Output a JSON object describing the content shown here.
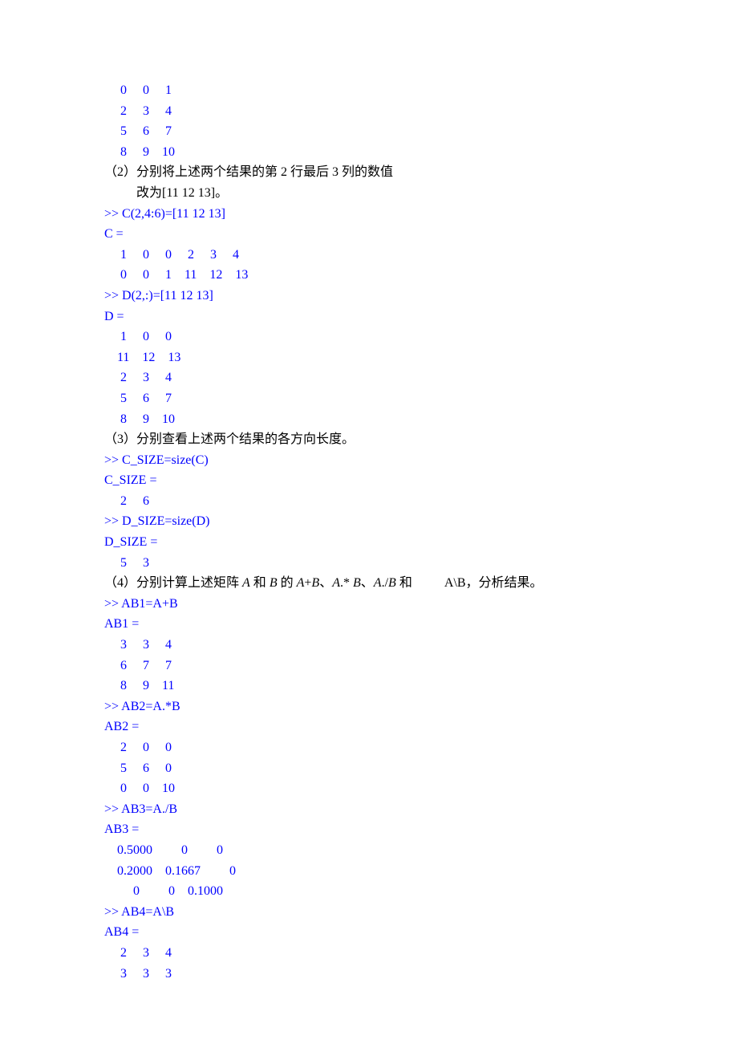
{
  "lines": [
    {
      "cls": "code",
      "text": "     0     0     1"
    },
    {
      "cls": "code",
      "text": "     2     3     4"
    },
    {
      "cls": "code",
      "text": "     5     6     7"
    },
    {
      "cls": "code",
      "text": "     8     9    10"
    },
    {
      "cls": "text",
      "text": "（2）分别将上述两个结果的第 2 行最后 3 列的数值"
    },
    {
      "cls": "text",
      "text": "          改为[11 12 13]。"
    },
    {
      "cls": "code",
      "text": ">> C(2,4:6)=[11 12 13]"
    },
    {
      "cls": "code",
      "text": "C ="
    },
    {
      "cls": "code",
      "text": "     1     0     0     2     3     4"
    },
    {
      "cls": "code",
      "text": "     0     0     1    11    12    13"
    },
    {
      "cls": "code",
      "text": ">> D(2,:)=[11 12 13]"
    },
    {
      "cls": "code",
      "text": "D ="
    },
    {
      "cls": "code",
      "text": "     1     0     0"
    },
    {
      "cls": "code",
      "text": "    11    12    13"
    },
    {
      "cls": "code",
      "text": "     2     3     4"
    },
    {
      "cls": "code",
      "text": "     5     6     7"
    },
    {
      "cls": "code",
      "text": "     8     9    10"
    },
    {
      "cls": "text",
      "text": "（3）分别查看上述两个结果的各方向长度。"
    },
    {
      "cls": "code",
      "text": ">> C_SIZE=size(C)"
    },
    {
      "cls": "code",
      "text": "C_SIZE ="
    },
    {
      "cls": "code",
      "text": "     2     6"
    },
    {
      "cls": "code",
      "text": ">> D_SIZE=size(D)"
    },
    {
      "cls": "code",
      "text": "D_SIZE ="
    },
    {
      "cls": "code",
      "text": "     5     3"
    },
    {
      "cls": "mixed",
      "segments": [
        {
          "cls": "text",
          "text": "（4）分别计算上述矩阵 "
        },
        {
          "cls": "text italic",
          "text": "A"
        },
        {
          "cls": "text",
          "text": " 和 "
        },
        {
          "cls": "text italic",
          "text": "B"
        },
        {
          "cls": "text",
          "text": " 的 "
        },
        {
          "cls": "text italic",
          "text": "A"
        },
        {
          "cls": "text",
          "text": "+"
        },
        {
          "cls": "text italic",
          "text": "B"
        },
        {
          "cls": "text",
          "text": "、"
        },
        {
          "cls": "text italic",
          "text": "A"
        },
        {
          "cls": "text",
          "text": ".* "
        },
        {
          "cls": "text italic",
          "text": "B"
        },
        {
          "cls": "text",
          "text": "、"
        },
        {
          "cls": "text italic",
          "text": "A"
        },
        {
          "cls": "text",
          "text": "./"
        },
        {
          "cls": "text italic",
          "text": "B"
        },
        {
          "cls": "text",
          "text": " 和          A\\B，分析结果。"
        }
      ]
    },
    {
      "cls": "code",
      "text": ">> AB1=A+B"
    },
    {
      "cls": "code",
      "text": "AB1 ="
    },
    {
      "cls": "code",
      "text": "     3     3     4"
    },
    {
      "cls": "code",
      "text": "     6     7     7"
    },
    {
      "cls": "code",
      "text": "     8     9    11"
    },
    {
      "cls": "code",
      "text": ">> AB2=A.*B"
    },
    {
      "cls": "code",
      "text": "AB2 ="
    },
    {
      "cls": "code",
      "text": "     2     0     0"
    },
    {
      "cls": "code",
      "text": "     5     6     0"
    },
    {
      "cls": "code",
      "text": "     0     0    10"
    },
    {
      "cls": "code",
      "text": ">> AB3=A./B"
    },
    {
      "cls": "code",
      "text": "AB3 ="
    },
    {
      "cls": "code",
      "text": "    0.5000         0         0"
    },
    {
      "cls": "code",
      "text": "    0.2000    0.1667         0"
    },
    {
      "cls": "code",
      "text": "         0         0    0.1000"
    },
    {
      "cls": "code",
      "text": ">> AB4=A\\B"
    },
    {
      "cls": "code",
      "text": "AB4 ="
    },
    {
      "cls": "code",
      "text": "     2     3     4"
    },
    {
      "cls": "code",
      "text": "     3     3     3"
    }
  ]
}
